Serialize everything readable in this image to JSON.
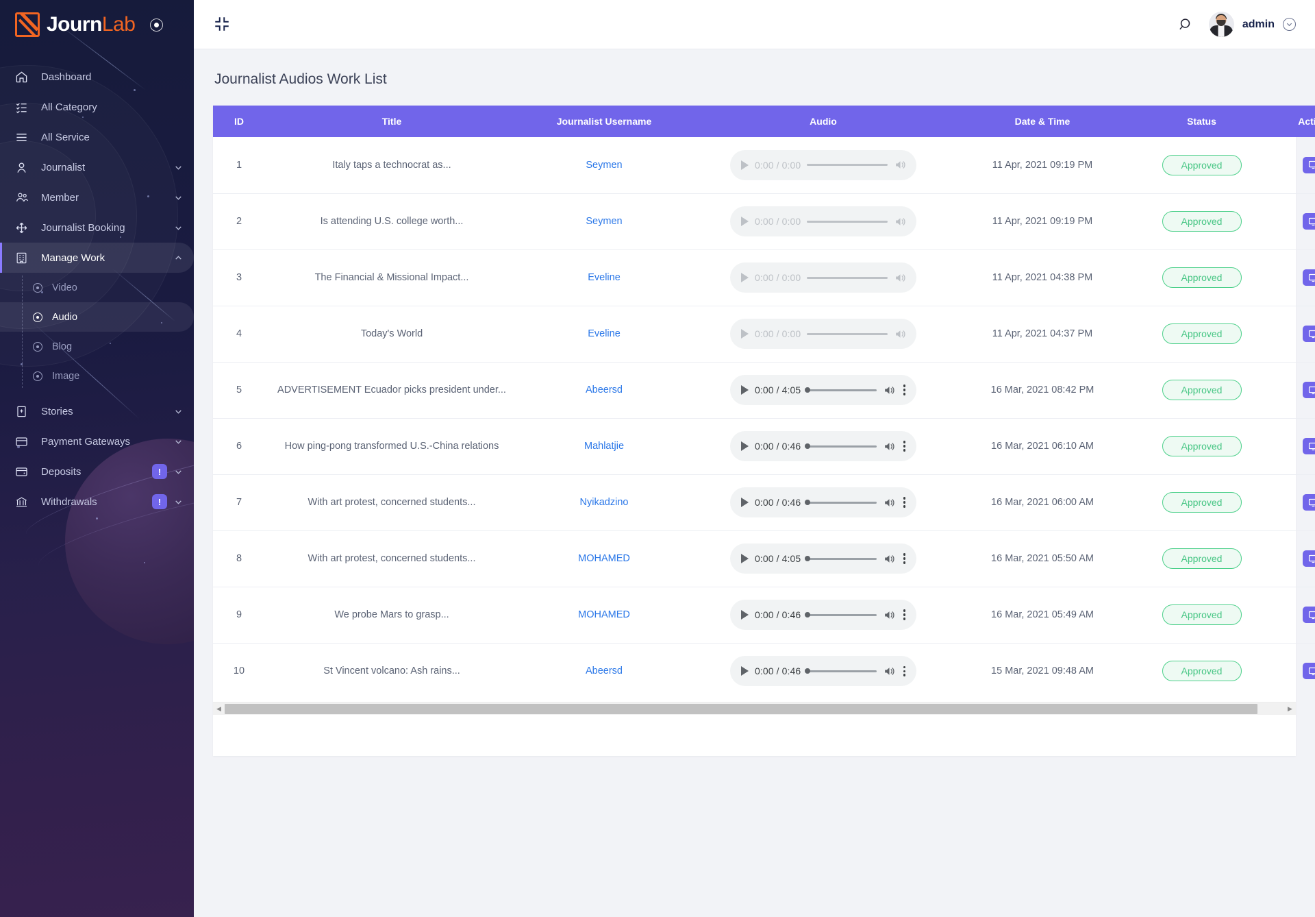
{
  "brand": {
    "name_first": "Journ",
    "name_second": "Lab",
    "logo_icon": "pen-square-icon",
    "toggle_icon": "record-dot-icon"
  },
  "sidebar": {
    "items": [
      {
        "label": "Dashboard",
        "icon": "home-icon",
        "has_chevron": false,
        "badge": null,
        "active": false
      },
      {
        "label": "All Category",
        "icon": "checklist-icon",
        "has_chevron": false,
        "badge": null,
        "active": false
      },
      {
        "label": "All Service",
        "icon": "menu-lines-icon",
        "has_chevron": false,
        "badge": null,
        "active": false
      },
      {
        "label": "Journalist",
        "icon": "user-icon",
        "has_chevron": true,
        "badge": null,
        "active": false
      },
      {
        "label": "Member",
        "icon": "users-group-icon",
        "has_chevron": true,
        "badge": null,
        "active": false
      },
      {
        "label": "Journalist Booking",
        "icon": "move-arrows-icon",
        "has_chevron": true,
        "badge": null,
        "active": false
      },
      {
        "label": "Manage Work",
        "icon": "building-grid-icon",
        "has_chevron": true,
        "badge": null,
        "active": true
      }
    ],
    "submenu": [
      {
        "label": "Video",
        "icon": "radio-dot-icon",
        "active": false
      },
      {
        "label": "Audio",
        "icon": "radio-dot-icon",
        "active": true
      },
      {
        "label": "Blog",
        "icon": "radio-dot-icon",
        "active": false
      },
      {
        "label": "Image",
        "icon": "radio-dot-icon",
        "active": false
      }
    ],
    "items_after": [
      {
        "label": "Stories",
        "icon": "book-plus-icon",
        "has_chevron": true,
        "badge": null,
        "active": false
      },
      {
        "label": "Payment Gateways",
        "icon": "card-icon",
        "has_chevron": true,
        "badge": null,
        "active": false
      },
      {
        "label": "Deposits",
        "icon": "wallet-icon",
        "has_chevron": true,
        "badge": "!",
        "active": false
      },
      {
        "label": "Withdrawals",
        "icon": "bank-icon",
        "has_chevron": true,
        "badge": "!",
        "active": false
      }
    ]
  },
  "topbar": {
    "collapse_icon": "compress-icon",
    "search_icon": "search-icon",
    "user_name": "admin",
    "avatar_icon": "user-avatar",
    "dropdown_icon": "chevron-down-circle-icon"
  },
  "page": {
    "title": "Journalist Audios Work List"
  },
  "table": {
    "columns": [
      "ID",
      "Title",
      "Journalist Username",
      "Audio",
      "Date & Time",
      "Status",
      "Action"
    ],
    "action_icon": "monitor-icon",
    "rows": [
      {
        "id": "1",
        "title": "Italy taps a technocrat as...",
        "user": "Seymen",
        "time": "0:00 / 0:00",
        "enabled": false,
        "date": "11 Apr, 2021 09:19 PM",
        "status": "Approved"
      },
      {
        "id": "2",
        "title": "Is attending U.S. college worth...",
        "user": "Seymen",
        "time": "0:00 / 0:00",
        "enabled": false,
        "date": "11 Apr, 2021 09:19 PM",
        "status": "Approved"
      },
      {
        "id": "3",
        "title": "The Financial & Missional Impact...",
        "user": "Eveline",
        "time": "0:00 / 0:00",
        "enabled": false,
        "date": "11 Apr, 2021 04:38 PM",
        "status": "Approved"
      },
      {
        "id": "4",
        "title": "Today's World",
        "user": "Eveline",
        "time": "0:00 / 0:00",
        "enabled": false,
        "date": "11 Apr, 2021 04:37 PM",
        "status": "Approved"
      },
      {
        "id": "5",
        "title": "ADVERTISEMENT Ecuador picks president under...",
        "user": "Abeersd",
        "time": "0:00 / 4:05",
        "enabled": true,
        "date": "16 Mar, 2021 08:42 PM",
        "status": "Approved"
      },
      {
        "id": "6",
        "title": "How ping-pong transformed U.S.-China relations",
        "user": "Mahlatjie",
        "time": "0:00 / 0:46",
        "enabled": true,
        "date": "16 Mar, 2021 06:10 AM",
        "status": "Approved"
      },
      {
        "id": "7",
        "title": "With art protest, concerned students...",
        "user": "Nyikadzino",
        "time": "0:00 / 0:46",
        "enabled": true,
        "date": "16 Mar, 2021 06:00 AM",
        "status": "Approved"
      },
      {
        "id": "8",
        "title": "With art protest, concerned students...",
        "user": "MOHAMED",
        "time": "0:00 / 4:05",
        "enabled": true,
        "date": "16 Mar, 2021 05:50 AM",
        "status": "Approved"
      },
      {
        "id": "9",
        "title": "We probe Mars to grasp...",
        "user": "MOHAMED",
        "time": "0:00 / 0:46",
        "enabled": true,
        "date": "16 Mar, 2021 05:49 AM",
        "status": "Approved"
      },
      {
        "id": "10",
        "title": "St Vincent volcano: Ash rains...",
        "user": "Abeersd",
        "time": "0:00 / 0:46",
        "enabled": true,
        "date": "15 Mar, 2021 09:48 AM",
        "status": "Approved"
      }
    ]
  },
  "scrollbar": {
    "left_arrow_icon": "chevron-left-icon",
    "right_arrow_icon": "chevron-right-icon"
  },
  "colors": {
    "accent_purple": "#7165ea",
    "brand_orange": "#f26522",
    "link_blue": "#2a77e8",
    "status_green": "#45c583",
    "sidebar_dark": "#171c3a"
  }
}
